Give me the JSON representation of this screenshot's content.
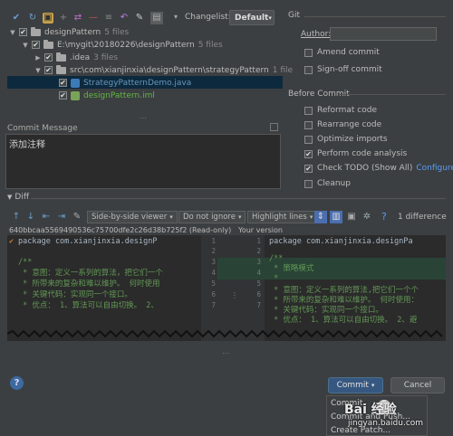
{
  "toolbar": {
    "icons": [
      "refresh-icon",
      "rollback-icon",
      "group-icon",
      "move-icon",
      "delete-icon",
      "diff-icon",
      "revert-icon",
      "edit-icon",
      "changelist-icon"
    ],
    "changelist_label": "Changelist:",
    "changelist_value": "Default"
  },
  "tree": {
    "items": [
      {
        "label": "designPattern",
        "count": "5 files"
      },
      {
        "label": "E:\\mygit\\20180226\\designPattern",
        "count": "5 files"
      },
      {
        "label": ".idea",
        "count": "3 files"
      },
      {
        "label": "src\\com\\xianjinxia\\designPattern\\strategyPattern",
        "count": "1 file"
      },
      {
        "label": "StrategyPatternDemo.java",
        "count": ""
      },
      {
        "label": "designPattern.iml",
        "count": ""
      }
    ]
  },
  "git": {
    "title": "Git",
    "author_label": "Author:",
    "author_value": "",
    "amend_label": "Amend commit",
    "signoff_label": "Sign-off commit"
  },
  "before_commit": {
    "title": "Before Commit",
    "options": [
      {
        "label": "Reformat code",
        "checked": false
      },
      {
        "label": "Rearrange code",
        "checked": false
      },
      {
        "label": "Optimize imports",
        "checked": false
      },
      {
        "label": "Perform code analysis",
        "checked": true
      },
      {
        "label": "Check TODO (Show All)",
        "checked": true
      },
      {
        "label": "Cleanup",
        "checked": false
      }
    ],
    "configure_link": "Configure"
  },
  "commit_message": {
    "label": "Commit Message",
    "text": "添加注释"
  },
  "diff": {
    "title": "Diff",
    "viewer_mode": "Side-by-side viewer",
    "ignore_mode": "Do not ignore",
    "highlight_mode": "Highlight lines",
    "help": "?",
    "difference_count": "1 difference",
    "left_header": "640bbcaa5569490536c75700dfe2c26d38b725f2 (Read-only)",
    "right_header": "Your version",
    "left_lines": [
      "package com.xianjinxia.designP",
      "",
      "/**",
      " * 意图：定义一系列的算法，把它们一个",
      " * 所带来的复杂和难以维护。 何时使用",
      " * 关键代码：实现同一个接口。",
      " * 优点： 1、算法可以自由切换。 2、"
    ],
    "right_lines": [
      "package com.xianjinxia.designPa",
      "",
      "/**",
      " * 策略模式",
      " *",
      " * 意图：定义一系列的算法,把它们一个个",
      " * 所带来的复杂和难以维护。 何时使用：",
      " * 关键代码：实现同一个接口。",
      " * 优点： 1、算法可以自由切换。 2、避"
    ],
    "left_numbers": [
      "1",
      "2",
      "3",
      "4",
      "5",
      "6",
      "7"
    ],
    "right_numbers": [
      "1",
      "2",
      "3",
      "4",
      "5",
      "6",
      "7",
      "8",
      "9"
    ]
  },
  "buttons": {
    "help": "?",
    "commit": "Commit",
    "cancel": "Cancel"
  },
  "commit_menu": {
    "items": [
      "Commit",
      "Commit and Push...",
      "Create Patch..."
    ]
  },
  "watermark": {
    "brand": "Bai 经验",
    "url": "jingyan.baidu.com"
  },
  "colors": {
    "background": "#3c3f41",
    "selection": "#0d293e",
    "added": "#294436",
    "link": "#589df6",
    "keyword": "#cc7832",
    "comment": "#629755"
  }
}
